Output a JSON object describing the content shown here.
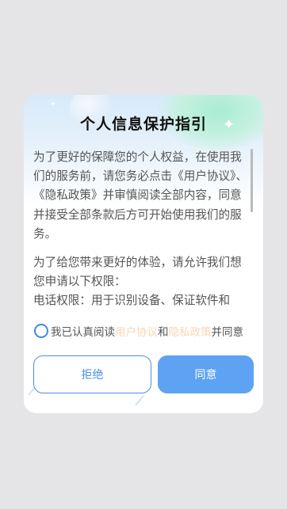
{
  "dialog": {
    "title": "个人信息保护指引",
    "paragraph1": "为了更好的保障您的个人权益，在使用我们的服务前，请您务必点击《用户协议》、《隐私政策》并审慎阅读全部内容，同意并接受全部条款后方可开始使用我们的服务。",
    "paragraph2": "为了给您带来更好的体验，请允许我们想您申请以下权限：",
    "paragraph3": "电话权限：用于识别设备、保证软件和"
  },
  "consent": {
    "prefix": "我已认真阅读",
    "user_agreement_link": "用户协议",
    "conjunction": "和",
    "privacy_policy_link": "隐私政策",
    "suffix": "并同意",
    "checked": false
  },
  "buttons": {
    "reject_label": "拒绝",
    "agree_label": "同意"
  },
  "colors": {
    "accent": "#4a8ee6",
    "agree_button": "#5ea2f3",
    "link": "#f7d7b4",
    "background": "#e5e5e7"
  }
}
